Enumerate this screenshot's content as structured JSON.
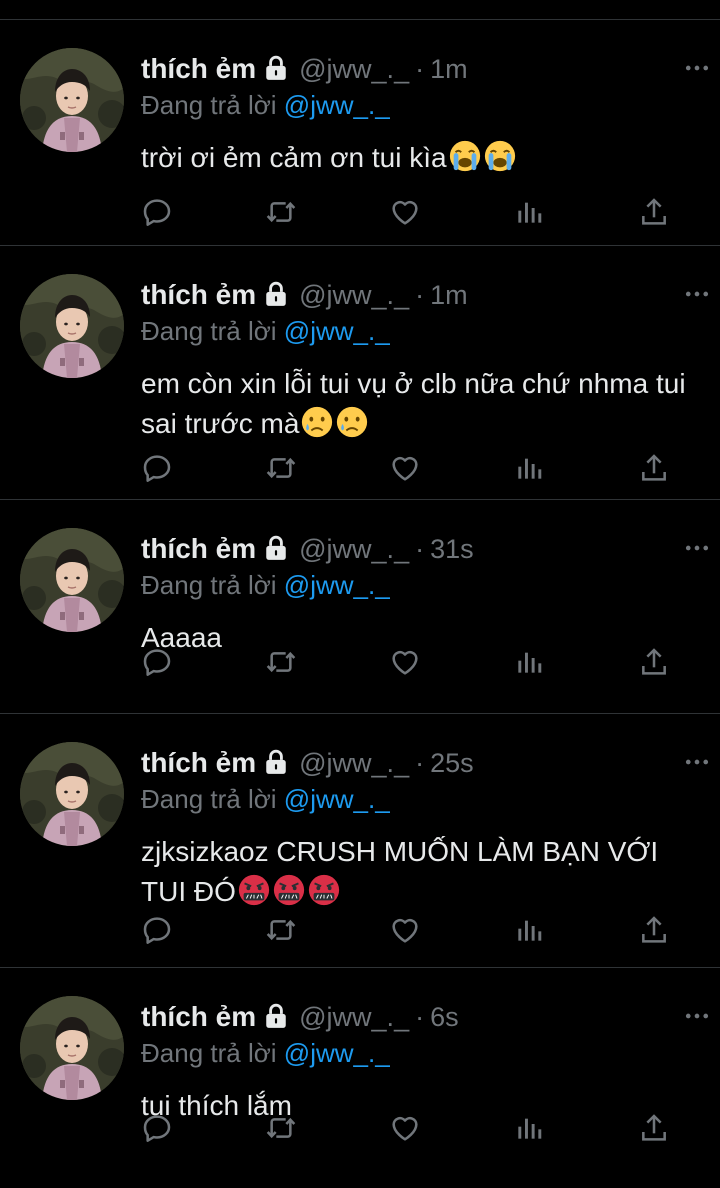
{
  "colors": {
    "background": "#000000",
    "text": "#e7e9ea",
    "muted": "#71767b",
    "accent": "#1d9bf0",
    "divider": "#2f3336"
  },
  "tweets": [
    {
      "name": "thích ẻm",
      "handle": "@jww_._",
      "dot": "·",
      "time": "1m",
      "reply_prefix": "Đang trả lời",
      "reply_handle": "@jww_._",
      "text": "trời ơi ẻm cảm ơn tui kìa",
      "emoji_icons": [
        "loudly-crying-face-icon",
        "loudly-crying-face-icon"
      ]
    },
    {
      "name": "thích ẻm",
      "handle": "@jww_._",
      "dot": "·",
      "time": "1m",
      "reply_prefix": "Đang trả lời",
      "reply_handle": "@jww_._",
      "text": "em còn xin lỗi tui vụ ở clb nữa chứ nhma tui sai trước mà",
      "emoji_icons": [
        "crying-face-icon",
        "crying-face-icon"
      ]
    },
    {
      "name": "thích ẻm",
      "handle": "@jww_._",
      "dot": "·",
      "time": "31s",
      "reply_prefix": "Đang trả lời",
      "reply_handle": "@jww_._",
      "text": "Aaaaa",
      "emoji_icons": []
    },
    {
      "name": "thích ẻm",
      "handle": "@jww_._",
      "dot": "·",
      "time": "25s",
      "reply_prefix": "Đang trả lời",
      "reply_handle": "@jww_._",
      "text": "zjksizkaoz CRUSH MUỐN LÀM BẠN VỚI TUI ĐÓ",
      "emoji_icons": [
        "face-with-symbols-on-mouth-icon",
        "face-with-symbols-on-mouth-icon",
        "face-with-symbols-on-mouth-icon"
      ]
    },
    {
      "name": "thích ẻm",
      "handle": "@jww_._",
      "dot": "·",
      "time": "6s",
      "reply_prefix": "Đang trả lời",
      "reply_handle": "@jww_._",
      "text": "tui thích lắm",
      "emoji_icons": []
    }
  ],
  "action_icons": [
    "reply-icon",
    "retweet-icon",
    "like-icon",
    "views-icon",
    "share-icon"
  ]
}
